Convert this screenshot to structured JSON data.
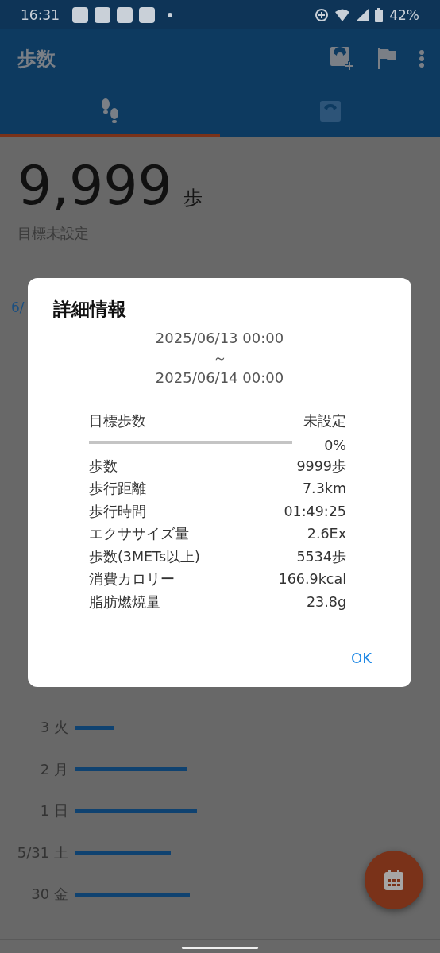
{
  "status_bar": {
    "time": "16:31",
    "battery": "42%"
  },
  "app_bar": {
    "title": "歩数"
  },
  "tabs": [
    {
      "selected": true
    },
    {
      "selected": false
    }
  ],
  "summary": {
    "steps": "9,999",
    "unit": "歩",
    "goal": "目標未設定"
  },
  "chart": {
    "date_label": "6/",
    "rows": [
      {
        "label": "3 火"
      },
      {
        "label": "2 月"
      },
      {
        "label": "1 日"
      },
      {
        "label": "5/31 土"
      },
      {
        "label": "30 金"
      }
    ]
  },
  "dialog": {
    "title": "詳細情報",
    "from": "2025/06/13 00:00",
    "separator": "～",
    "to": "2025/06/14 00:00",
    "goal": {
      "label": "目標歩数",
      "value": "未設定",
      "percent": "0%"
    },
    "rows": [
      {
        "label": "歩数",
        "value": "9999歩"
      },
      {
        "label": "歩行距離",
        "value": "7.3km"
      },
      {
        "label": "歩行時間",
        "value": "01:49:25"
      },
      {
        "label": "エクササイズ量",
        "value": "2.6Ex"
      },
      {
        "label": "歩数(3METs以上)",
        "value": "5534歩"
      },
      {
        "label": "消費カロリー",
        "value": "166.9kcal"
      },
      {
        "label": "脂肪燃焼量",
        "value": "23.8g"
      }
    ],
    "button": "OK"
  }
}
